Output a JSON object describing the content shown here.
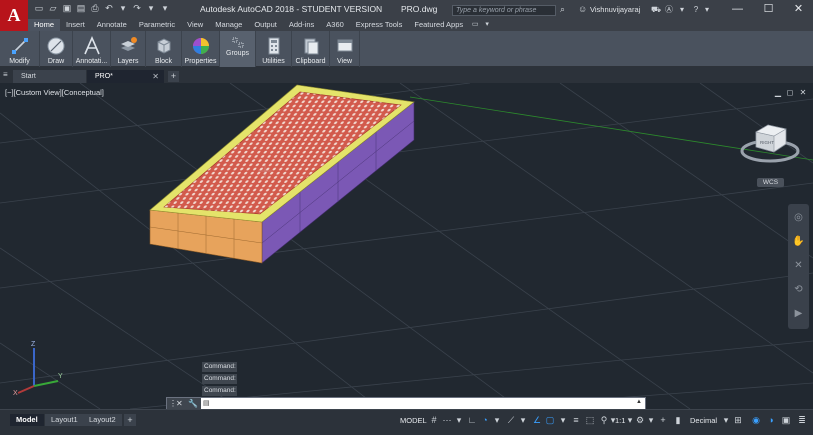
{
  "app": {
    "title": "Autodesk AutoCAD 2018 - STUDENT VERSION",
    "document": "PRO.dwg",
    "logo_letter": "A"
  },
  "search": {
    "placeholder": "Type a keyword or phrase"
  },
  "user": {
    "name": "Vishnuvijayaraj"
  },
  "ribbon_tabs": [
    "Home",
    "Insert",
    "Annotate",
    "Parametric",
    "View",
    "Manage",
    "Output",
    "Add-ins",
    "A360",
    "Express Tools",
    "Featured Apps"
  ],
  "ribbon_groups": [
    {
      "label": "Modify",
      "icon": "modify-icon"
    },
    {
      "label": "Draw",
      "icon": "draw-icon"
    },
    {
      "label": "Annotati...",
      "icon": "annotation-icon"
    },
    {
      "label": "Layers",
      "icon": "layers-icon"
    },
    {
      "label": "Block",
      "icon": "block-icon"
    },
    {
      "label": "Properties",
      "icon": "properties-icon"
    },
    {
      "label": "Groups",
      "icon": "groups-icon"
    },
    {
      "label": "Utilities",
      "icon": "utilities-icon"
    },
    {
      "label": "Clipboard",
      "icon": "clipboard-icon"
    },
    {
      "label": "View",
      "icon": "view-icon"
    }
  ],
  "file_tabs": [
    {
      "label": "Start",
      "active": false
    },
    {
      "label": "PRO*",
      "active": true
    }
  ],
  "viewport": {
    "label": "[−][Custom View][Conceptual]",
    "wcs_label": "WCS",
    "viewcube_face": "RIGHT"
  },
  "command_history": [
    "Command:",
    "Command:",
    "Command:"
  ],
  "command_line": {
    "prompt": "▤",
    "value": ""
  },
  "layout_tabs": [
    {
      "label": "Model",
      "active": true
    },
    {
      "label": "Layout1",
      "active": false
    },
    {
      "label": "Layout2",
      "active": false
    }
  ],
  "status": {
    "model": "MODEL",
    "scale": "1:1",
    "units": "Decimal"
  },
  "colors": {
    "logo_red": "#b8141b",
    "top_face": "#d25a4c",
    "frame_yellow": "#e4e36a",
    "front_orange": "#e7a35c",
    "side_purple": "#7b58b5",
    "grid_line": "#3a424c",
    "axis_x": "#b13a3a",
    "axis_y": "#38a838",
    "axis_z": "#3a66c9"
  }
}
